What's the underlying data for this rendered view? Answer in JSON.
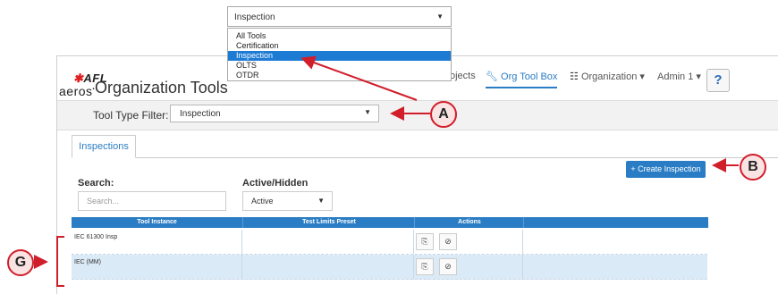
{
  "dropdown": {
    "selected": "Inspection",
    "options": [
      "All Tools",
      "Certification",
      "Inspection",
      "OLTS",
      "OTDR"
    ],
    "highlighted_index": 2
  },
  "logo": {
    "brand": "AFL",
    "product": "aeros"
  },
  "page_title": "Organization Tools",
  "nav": {
    "projects": "ojects",
    "org_toolbox": "Org Tool Box",
    "organization": "Organization",
    "admin": "Admin 1",
    "help": "?"
  },
  "filter": {
    "label": "Tool Type Filter:",
    "value": "Inspection"
  },
  "tab": {
    "label": "Inspections"
  },
  "create_button": "+ Create Inspection",
  "search": {
    "label": "Search:",
    "placeholder": "Search..."
  },
  "active_hidden": {
    "label": "Active/Hidden",
    "value": "Active"
  },
  "table": {
    "columns": [
      "Tool Instance",
      "Test Limits Preset",
      "Actions"
    ],
    "rows": [
      {
        "tool_instance": "IEC 61300 Insp",
        "test_limits_preset": ""
      },
      {
        "tool_instance": "IEC (MM)",
        "test_limits_preset": ""
      }
    ]
  },
  "callouts": {
    "a": "A",
    "b": "B",
    "g": "G"
  },
  "colors": {
    "accent": "#2a7dc4",
    "selected_option": "#1e7bd4",
    "callout_red": "#d11e2b",
    "row_alt": "#dbeaf7"
  }
}
